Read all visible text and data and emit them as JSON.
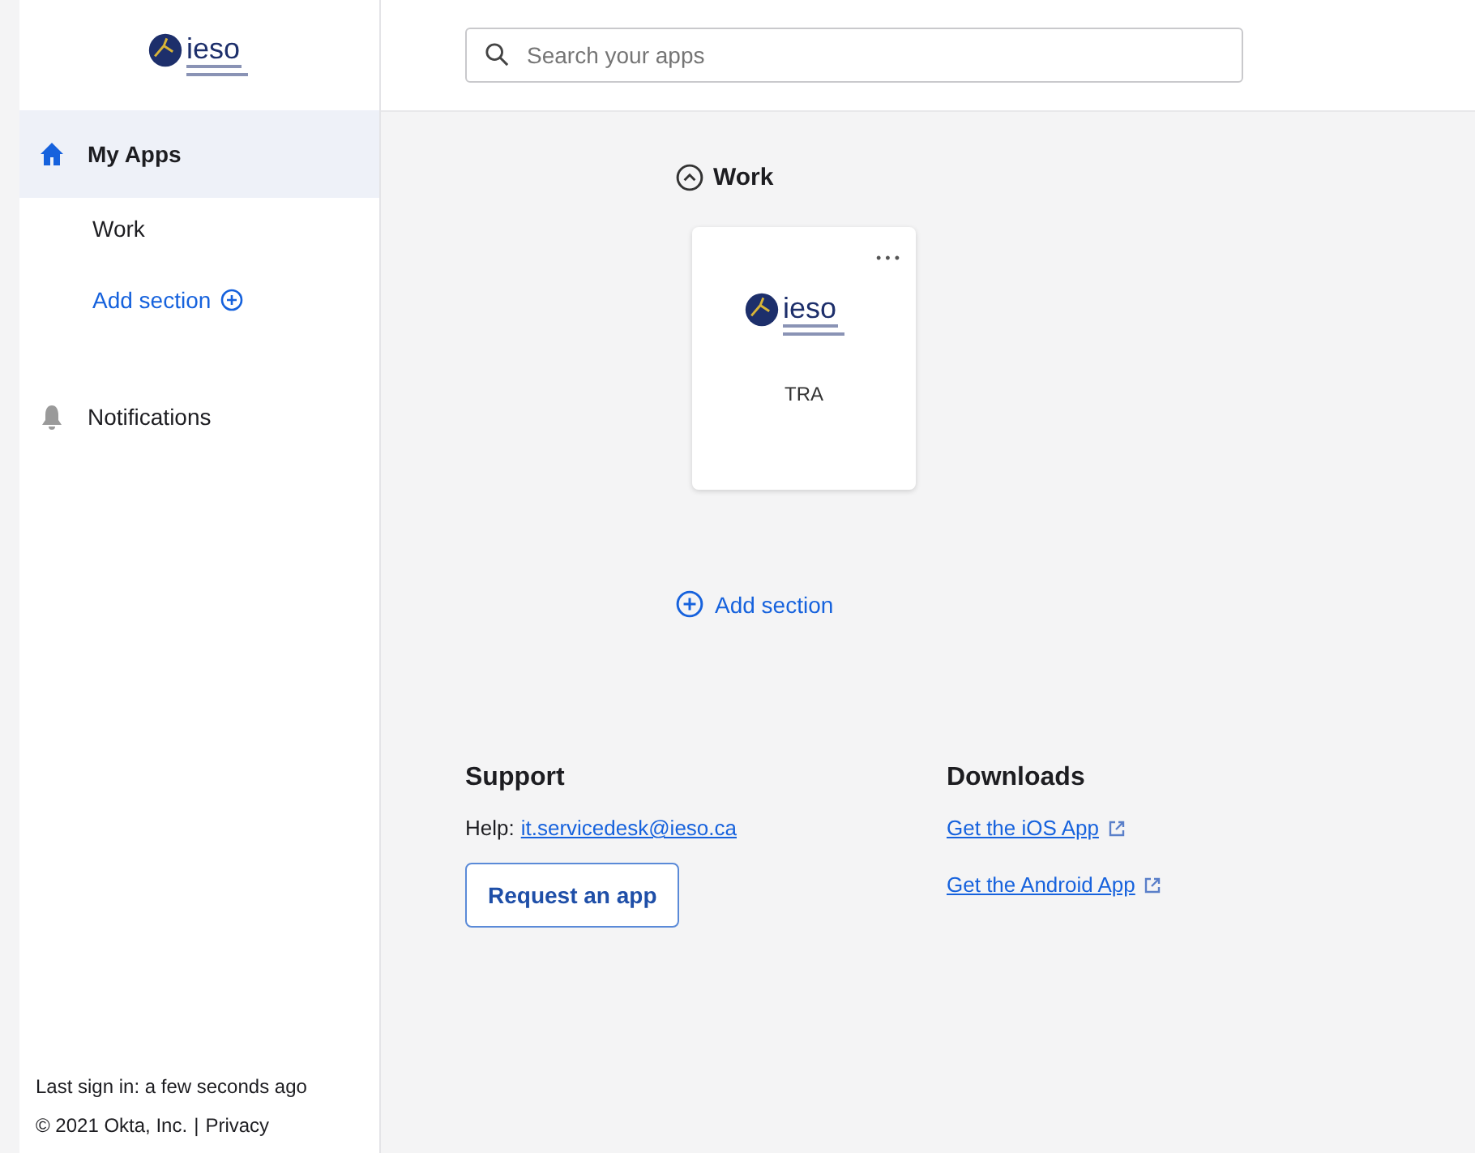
{
  "brand": {
    "logo_text": "ieso"
  },
  "search": {
    "placeholder": "Search your apps"
  },
  "sidebar": {
    "items": [
      {
        "kind": "home",
        "label": "My Apps",
        "selected": true
      },
      {
        "kind": "sub",
        "label": "Work",
        "selected": false
      },
      {
        "kind": "add",
        "label": "Add section",
        "selected": false
      },
      {
        "kind": "bell",
        "label": "Notifications",
        "selected": false
      }
    ],
    "last_sign_in": "Last sign in: a few seconds ago",
    "copyright": "© 2021 Okta, Inc.",
    "separator": "|",
    "privacy_link": "Privacy"
  },
  "section": {
    "title": "Work",
    "expanded": true,
    "apps": [
      {
        "logo_text": "ieso",
        "label": "TRA",
        "menu": "• • •"
      }
    ],
    "add_section": "Add section"
  },
  "support": {
    "title": "Support",
    "help_label": "Help:",
    "email": "it.servicedesk@ieso.ca",
    "button": "Request an app"
  },
  "downloads": {
    "title": "Downloads",
    "links": [
      "Get the iOS App",
      "Get the Android App"
    ]
  }
}
